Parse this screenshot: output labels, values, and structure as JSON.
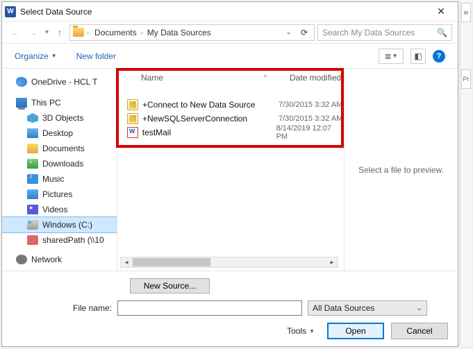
{
  "title": "Select Data Source",
  "breadcrumbs": {
    "seg1": "Documents",
    "seg2": "My Data Sources"
  },
  "search": {
    "placeholder": "Search My Data Sources"
  },
  "toolbar": {
    "organize": "Organize",
    "newfolder": "New folder"
  },
  "sidebar": {
    "onedrive": "OneDrive - HCL T",
    "thispc": "This PC",
    "objects3d": "3D Objects",
    "desktop": "Desktop",
    "documents": "Documents",
    "downloads": "Downloads",
    "music": "Music",
    "pictures": "Pictures",
    "videos": "Videos",
    "cdrive": "Windows (C:)",
    "shared": "sharedPath (\\\\10",
    "network": "Network"
  },
  "columns": {
    "name": "Name",
    "date": "Date modified"
  },
  "files": [
    {
      "name": "+Connect to New Data Source",
      "date": "7/30/2015 3:32 AM",
      "kind": "odc"
    },
    {
      "name": "+NewSQLServerConnection",
      "date": "7/30/2015 3:32 AM",
      "kind": "odc"
    },
    {
      "name": "testMail",
      "date": "8/14/2019 12:07 PM",
      "kind": "doc"
    }
  ],
  "preview": {
    "empty": "Select a file to preview."
  },
  "footer": {
    "newsource": "New Source...",
    "filename_label": "File name:",
    "filter": "All Data Sources",
    "tools": "Tools",
    "open": "Open",
    "cancel": "Cancel"
  },
  "rightedge": {
    "t1": "ie",
    "t2": "Pr"
  }
}
